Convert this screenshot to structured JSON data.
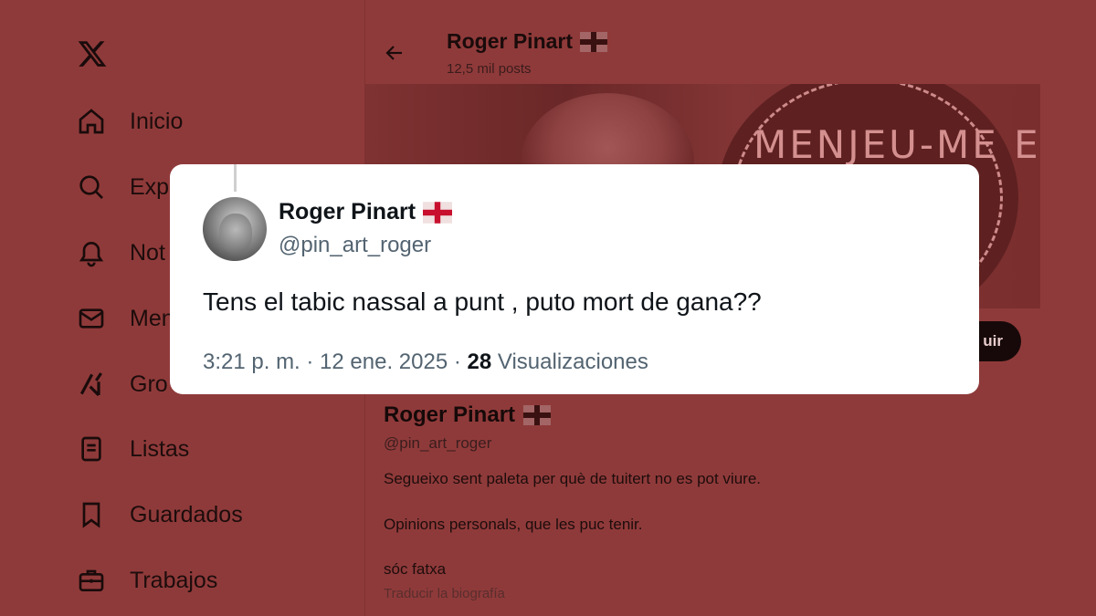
{
  "sidebar": {
    "items": [
      {
        "icon": "home-icon",
        "label": "Inicio"
      },
      {
        "icon": "search-icon",
        "label": "Exp"
      },
      {
        "icon": "bell-icon",
        "label": "Not"
      },
      {
        "icon": "mail-icon",
        "label": "Men"
      },
      {
        "icon": "grok-icon",
        "label": "Gro"
      },
      {
        "icon": "list-icon",
        "label": "Listas"
      },
      {
        "icon": "bookmark-icon",
        "label": "Guardados"
      },
      {
        "icon": "briefcase-icon",
        "label": "Trabajos"
      }
    ]
  },
  "header": {
    "name": "Roger Pinart",
    "posts": "12,5 mil posts"
  },
  "banner": {
    "text": "MENJEU-ME ELS"
  },
  "profile": {
    "follow_label": "uir",
    "name": "Roger Pinart",
    "handle": "@pin_art_roger",
    "bio": [
      "Segueixo sent paleta per què de tuitert no es pot viure.",
      "Opinions personals, que les puc tenir.",
      "sóc fatxa"
    ],
    "translate_label": "Traducir la biografía"
  },
  "tweet": {
    "name": "Roger Pinart",
    "handle": "@pin_art_roger",
    "text": "Tens el tabic nassal a punt , puto mort de gana??",
    "time_date": "3:21 p. m. · 12 ene. 2025 · ",
    "views_count": "28",
    "views_label": " Visualizaciones"
  },
  "colors": {
    "background": "#8f3a3a",
    "card": "#ffffff",
    "flag_cross": "#c8102e"
  }
}
